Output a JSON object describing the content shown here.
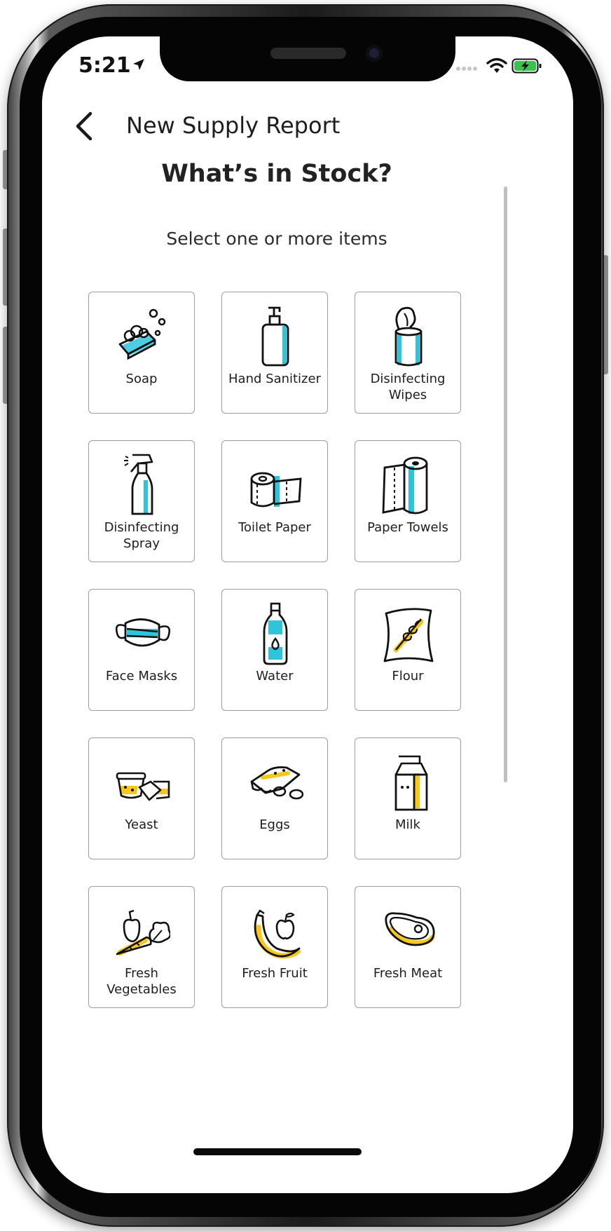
{
  "status_bar": {
    "time": "5:21"
  },
  "header": {
    "title": "New Supply Report",
    "back_icon": "chevron-left-icon"
  },
  "heading": "What’s in Stock?",
  "subtitle": "Select one or more items",
  "colors": {
    "accent_blue": "#2ec4dc",
    "accent_yellow": "#f7c81b",
    "battery_green": "#3ac34a"
  },
  "items": [
    {
      "label": "Soap",
      "icon": "soap-icon"
    },
    {
      "label": "Hand Sanitizer",
      "icon": "hand-sanitizer-icon"
    },
    {
      "label": "Disinfecting Wipes",
      "icon": "disinfecting-wipes-icon"
    },
    {
      "label": "Disinfecting Spray",
      "icon": "spray-bottle-icon"
    },
    {
      "label": "Toilet Paper",
      "icon": "toilet-paper-icon"
    },
    {
      "label": "Paper Towels",
      "icon": "paper-towels-icon"
    },
    {
      "label": "Face Masks",
      "icon": "face-mask-icon"
    },
    {
      "label": "Water",
      "icon": "water-bottle-icon"
    },
    {
      "label": "Flour",
      "icon": "flour-bag-icon"
    },
    {
      "label": "Yeast",
      "icon": "yeast-icon"
    },
    {
      "label": "Eggs",
      "icon": "eggs-icon"
    },
    {
      "label": "Milk",
      "icon": "milk-carton-icon"
    },
    {
      "label": "Fresh Vegetables",
      "icon": "vegetables-icon"
    },
    {
      "label": "Fresh Fruit",
      "icon": "fruit-icon"
    },
    {
      "label": "Fresh Meat",
      "icon": "meat-icon"
    }
  ]
}
